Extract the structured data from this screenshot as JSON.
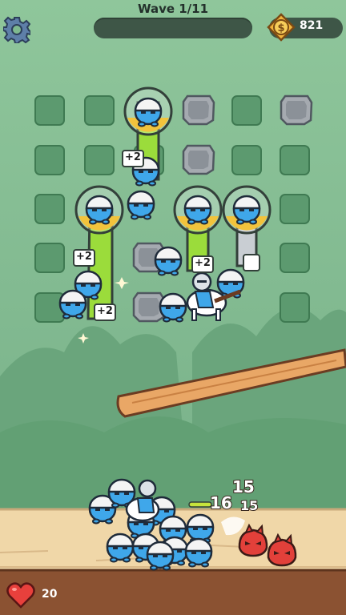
{
  "hud": {
    "wave_label": "Wave 1/11",
    "wave_progress": 0,
    "coins": "821",
    "coin_symbol": "$",
    "settings_icon": "gear-icon"
  },
  "board": {
    "bonus_labels": [
      "+2",
      "+2",
      "+2",
      "+2"
    ]
  },
  "battle": {
    "damage_numbers": [
      "15",
      "16",
      "15"
    ]
  },
  "footer": {
    "lives": "20",
    "lives_icon": "heart-icon"
  },
  "colors": {
    "sky": "#7fb98f",
    "cell": "#5c9a6f",
    "unit_blue": "#3fa7ea",
    "enemy_red": "#e2403a",
    "pipe_green": "#9bdc3b"
  }
}
